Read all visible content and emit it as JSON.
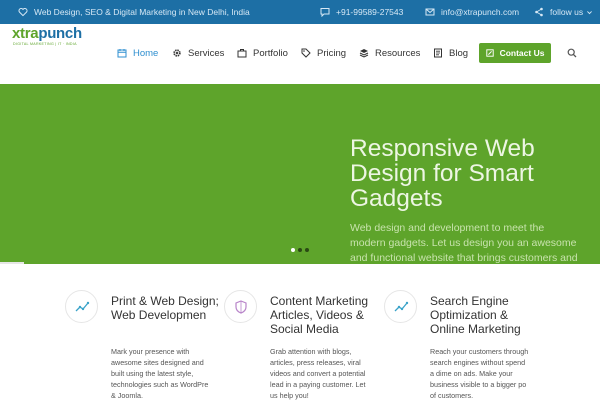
{
  "topbar": {
    "tagline": "Web Design, SEO & Digital Marketing in New Delhi, India",
    "phone": "+91-99589-27543",
    "email": "info@xtrapunch.com",
    "follow": "follow us"
  },
  "logo": {
    "first": "xtra",
    "rest": "punch",
    "tagline": "DIGITAL MARKETING | IT · INDIA"
  },
  "nav": {
    "items": [
      "Home",
      "Services",
      "Portfolio",
      "Pricing",
      "Resources",
      "Blog"
    ],
    "contact": "Contact Us",
    "active": "Home"
  },
  "hero": {
    "title": "Responsive Web Design for Smart Gadgets",
    "subtitle_lines": [
      "Web design and development to meet the",
      "modern gadgets. Let us design you an awesome",
      "and functional website that brings customers and"
    ],
    "slides": 3,
    "active_slide": 1
  },
  "features": [
    {
      "title": "Print & Web Design;\nWeb Developmen",
      "lines": [
        "Mark your presence with",
        "awesome sites designed and",
        "built using the latest style,",
        "technologies such as WordPre",
        "& Joomla."
      ]
    },
    {
      "title": "Content Marketing\nArticles, Videos &\nSocial Media",
      "lines": [
        "Grab attention with blogs,",
        "articles, press releases, viral",
        "videos and convert a potential",
        "lead in a paying customer. Let",
        "us help you!"
      ]
    },
    {
      "title": "Search Engine\nOptimization &\nOnline Marketing",
      "lines": [
        "Reach your customers through",
        "search engines without spend",
        "a dime on ads. Make your",
        "business visible to a bigger po",
        "of customers."
      ]
    }
  ],
  "colors": {
    "topbar": "#1d6fa5",
    "brand_green": "#5ea42b",
    "nav_active": "#2f8fd0"
  },
  "icons": {
    "topbar": [
      "heart-icon",
      "chat-icon",
      "mail-icon",
      "share-icon"
    ],
    "nav": [
      "calendar-icon",
      "gear-icon",
      "briefcase-icon",
      "tag-icon",
      "stack-icon",
      "document-icon"
    ],
    "features": [
      "trend-line-icon",
      "shield-icon",
      "trend-line-icon"
    ]
  }
}
